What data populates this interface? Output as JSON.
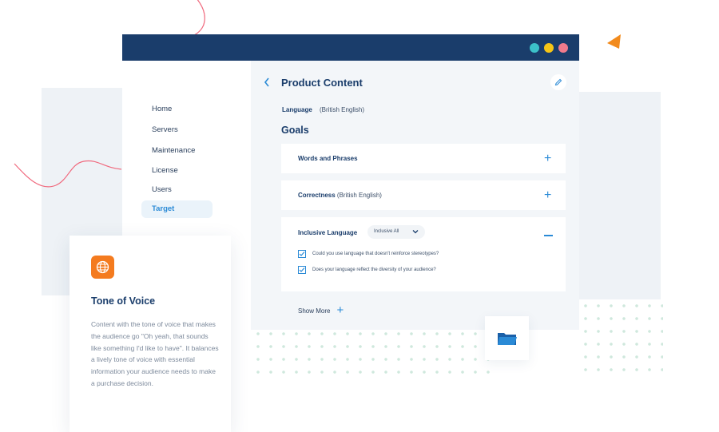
{
  "colors": {
    "titlebar": "#1a3d6b",
    "accent": "#2a8ad6",
    "tone_icon": "#f47b1f",
    "triangle": "#f28a1c",
    "squiggle": "#f06a7e",
    "traffic_teal": "#3cc1c9",
    "traffic_yellow": "#f6c516",
    "traffic_red": "#f07b8c"
  },
  "sidebar": {
    "items": [
      {
        "label": "Home"
      },
      {
        "label": "Servers"
      },
      {
        "label": "Maintenance"
      },
      {
        "label": "License"
      },
      {
        "label": "Users"
      },
      {
        "label": "Target",
        "active": true
      }
    ]
  },
  "content": {
    "title": "Product Content",
    "back_icon": "chevron-left-icon",
    "edit_icon": "pencil-icon",
    "language_label": "Language",
    "language_value": "(British English)",
    "goals_heading": "Goals",
    "cards": {
      "words": {
        "title": "Words and Phrases"
      },
      "correctness": {
        "title": "Correctness",
        "suffix": " (British English)"
      },
      "inclusive": {
        "title": "Inclusive Language",
        "select_value": "Inclusive All",
        "checks": [
          {
            "label": "Could you use language that doesn't reinforce stereotypes?",
            "checked": true
          },
          {
            "label": "Does your language reflect the diversity of your audience?",
            "checked": true
          }
        ]
      }
    },
    "show_more": "Show More"
  },
  "folder_card": {
    "icon": "folder-icon"
  },
  "tone_card": {
    "icon": "globe-icon",
    "title": "Tone of Voice",
    "body": "Content with the tone of voice that makes the audience go \"Oh yeah, that sounds like something I'd like to have\". It balances a lively tone of voice with essential information your audience needs to make a purchase decision."
  }
}
